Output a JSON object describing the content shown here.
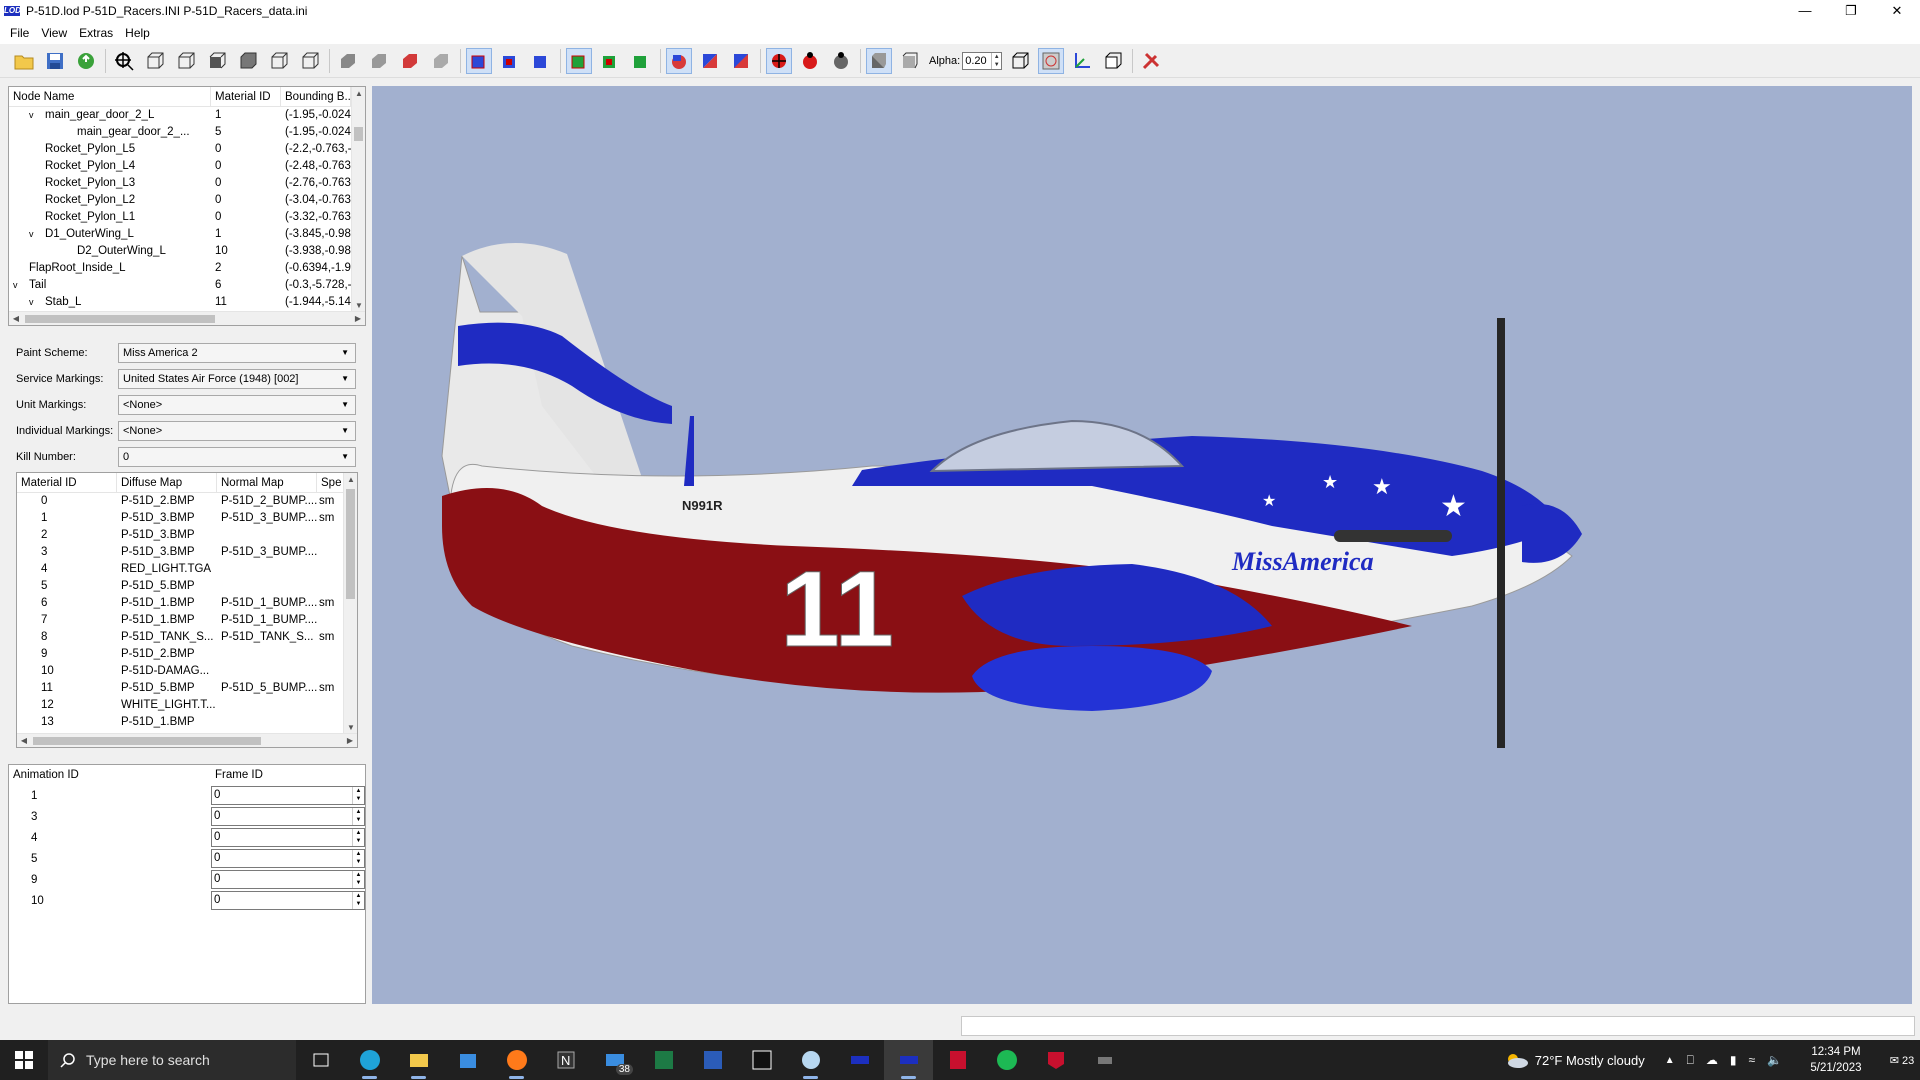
{
  "window": {
    "title": "P-51D.lod  P-51D_Racers.INI  P-51D_Racers_data.ini",
    "app_icon": "LOD",
    "controls": [
      "minimize-icon",
      "restore-icon",
      "close-icon"
    ]
  },
  "menu": [
    "File",
    "View",
    "Extras",
    "Help"
  ],
  "toolbar": {
    "alpha_label": "Alpha:",
    "alpha_value": "0.20"
  },
  "node_tree": {
    "headers": [
      "Node Name",
      "Material ID",
      "Bounding B..."
    ],
    "rows": [
      {
        "name": "main_gear_door_2_L",
        "indent": 2,
        "expander": "v",
        "material": "1",
        "bbox": "(-1.95,-0.024"
      },
      {
        "name": "main_gear_door_2_...",
        "indent": 4,
        "expander": "",
        "material": "5",
        "bbox": "(-1.95,-0.024"
      },
      {
        "name": "Rocket_Pylon_L5",
        "indent": 2,
        "expander": "",
        "material": "0",
        "bbox": "(-2.2,-0.763,-"
      },
      {
        "name": "Rocket_Pylon_L4",
        "indent": 2,
        "expander": "",
        "material": "0",
        "bbox": "(-2.48,-0.763"
      },
      {
        "name": "Rocket_Pylon_L3",
        "indent": 2,
        "expander": "",
        "material": "0",
        "bbox": "(-2.76,-0.763"
      },
      {
        "name": "Rocket_Pylon_L2",
        "indent": 2,
        "expander": "",
        "material": "0",
        "bbox": "(-3.04,-0.763"
      },
      {
        "name": "Rocket_Pylon_L1",
        "indent": 2,
        "expander": "",
        "material": "0",
        "bbox": "(-3.32,-0.763"
      },
      {
        "name": "D1_OuterWing_L",
        "indent": 2,
        "expander": "v",
        "material": "1",
        "bbox": "(-3.845,-0.98"
      },
      {
        "name": "D2_OuterWing_L",
        "indent": 4,
        "expander": "",
        "material": "10",
        "bbox": "(-3.938,-0.98"
      },
      {
        "name": "FlapRoot_Inside_L",
        "indent": 1,
        "expander": "",
        "material": "2",
        "bbox": "(-0.6394,-1.9"
      },
      {
        "name": "Tail",
        "indent": 1,
        "expander": "v",
        "material": "6",
        "bbox": "(-0.3,-5.728,-"
      },
      {
        "name": "Stab_L",
        "indent": 2,
        "expander": "v",
        "material": "11",
        "bbox": "(-1.944,-5.14"
      }
    ]
  },
  "markings": {
    "paint_scheme": {
      "label": "Paint Scheme:",
      "value": "Miss America 2"
    },
    "service_markings": {
      "label": "Service Markings:",
      "value": "United States Air Force (1948) [002]"
    },
    "unit_markings": {
      "label": "Unit Markings:",
      "value": "<None>"
    },
    "individual_markings": {
      "label": "Individual Markings:",
      "value": "<None>"
    },
    "kill_number": {
      "label": "Kill Number:",
      "value": "0"
    }
  },
  "materials": {
    "headers": [
      "Material ID",
      "Diffuse Map",
      "Normal Map",
      "Spe"
    ],
    "rows": [
      {
        "id": "0",
        "diffuse": "P-51D_2.BMP",
        "normal": "P-51D_2_BUMP....",
        "spec": "sm"
      },
      {
        "id": "1",
        "diffuse": "P-51D_3.BMP",
        "normal": "P-51D_3_BUMP....",
        "spec": "sm"
      },
      {
        "id": "2",
        "diffuse": "P-51D_3.BMP",
        "normal": "",
        "spec": ""
      },
      {
        "id": "3",
        "diffuse": "P-51D_3.BMP",
        "normal": "P-51D_3_BUMP....",
        "spec": ""
      },
      {
        "id": "4",
        "diffuse": "RED_LIGHT.TGA",
        "normal": "",
        "spec": ""
      },
      {
        "id": "5",
        "diffuse": "P-51D_5.BMP",
        "normal": "",
        "spec": ""
      },
      {
        "id": "6",
        "diffuse": "P-51D_1.BMP",
        "normal": "P-51D_1_BUMP....",
        "spec": "sm"
      },
      {
        "id": "7",
        "diffuse": "P-51D_1.BMP",
        "normal": "P-51D_1_BUMP....",
        "spec": ""
      },
      {
        "id": "8",
        "diffuse": "P-51D_TANK_S...",
        "normal": "P-51D_TANK_S...",
        "spec": "sm"
      },
      {
        "id": "9",
        "diffuse": "P-51D_2.BMP",
        "normal": "",
        "spec": ""
      },
      {
        "id": "10",
        "diffuse": "P-51D-DAMAG...",
        "normal": "",
        "spec": ""
      },
      {
        "id": "11",
        "diffuse": "P-51D_5.BMP",
        "normal": "P-51D_5_BUMP....",
        "spec": "sm"
      },
      {
        "id": "12",
        "diffuse": "WHITE_LIGHT.T...",
        "normal": "",
        "spec": ""
      },
      {
        "id": "13",
        "diffuse": "P-51D_1.BMP",
        "normal": "",
        "spec": ""
      }
    ]
  },
  "animations": {
    "headers": [
      "Animation ID",
      "Frame ID"
    ],
    "rows": [
      {
        "id": "1",
        "frame": "0"
      },
      {
        "id": "3",
        "frame": "0"
      },
      {
        "id": "4",
        "frame": "0"
      },
      {
        "id": "5",
        "frame": "0"
      },
      {
        "id": "9",
        "frame": "0"
      },
      {
        "id": "10",
        "frame": "0"
      }
    ]
  },
  "aircraft": {
    "registration": "N991R",
    "race_number": "11",
    "name": "MissAmerica",
    "colors": {
      "red": "#8a0f14",
      "blue": "#1f2bc2",
      "white": "#f2f2f2",
      "background": "#a2b0cf"
    }
  },
  "taskbar": {
    "search_placeholder": "Type here to search",
    "mail_badge": "38",
    "apps": [
      "edge",
      "file-explorer",
      "store",
      "firefox",
      "notion",
      "mail",
      "excel",
      "word",
      "7zip",
      "paint",
      "app-blue",
      "lod",
      "acrobat",
      "spotify",
      "mcafee",
      "misc"
    ],
    "weather": "72°F  Mostly cloudy",
    "time": "12:34 PM",
    "date": "5/21/2023",
    "notifications": "23"
  }
}
